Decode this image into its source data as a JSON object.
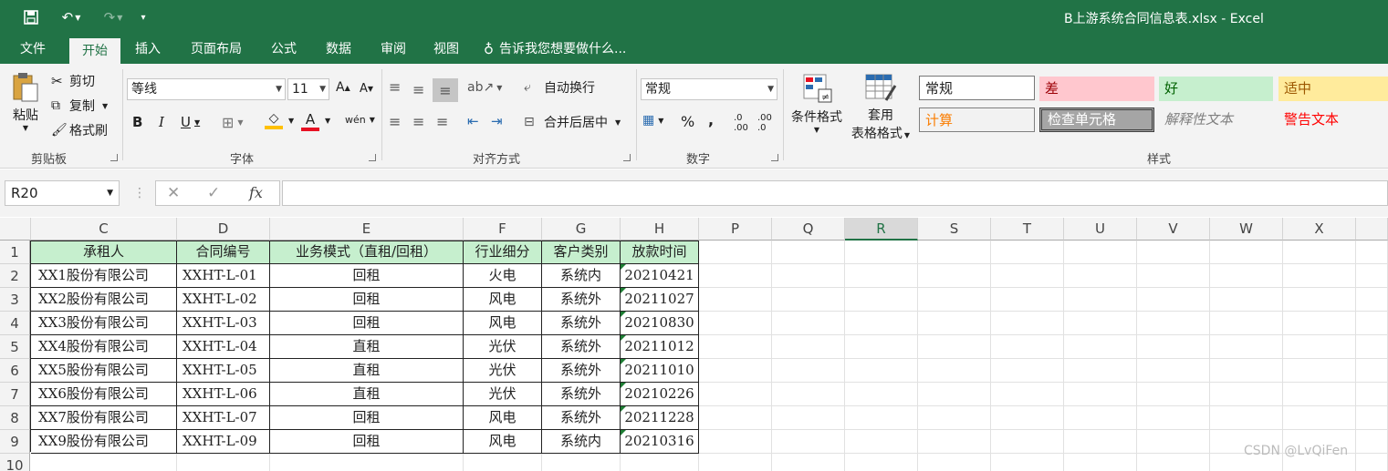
{
  "title": "B上游系统合同信息表.xlsx - Excel",
  "tabs": [
    "文件",
    "开始",
    "插入",
    "页面布局",
    "公式",
    "数据",
    "审阅",
    "视图"
  ],
  "tell_me": "告诉我您想要做什么...",
  "clipboard": {
    "paste": "粘贴",
    "cut": "剪切",
    "copy": "复制",
    "format_painter": "格式刷",
    "label": "剪贴板"
  },
  "font": {
    "name": "等线",
    "size": "11",
    "label": "字体"
  },
  "alignment": {
    "wrap": "自动换行",
    "merge": "合并后居中",
    "label": "对齐方式"
  },
  "number": {
    "format": "常规",
    "label": "数字"
  },
  "styles": {
    "cond_format": "条件格式",
    "table_format_1": "套用",
    "table_format_2": "表格格式",
    "cells": [
      "常规",
      "差",
      "好",
      "适中",
      "计算",
      "检查单元格",
      "解释性文本",
      "警告文本"
    ],
    "label": "样式"
  },
  "name_box": "R20",
  "columns": [
    "C",
    "D",
    "E",
    "F",
    "G",
    "H",
    "P",
    "Q",
    "R",
    "S",
    "T",
    "U",
    "V",
    "W",
    "X"
  ],
  "rows": [
    "1",
    "2",
    "3",
    "4",
    "5",
    "6",
    "7",
    "8",
    "9",
    "10"
  ],
  "table": {
    "headers": [
      "承租人",
      "合同编号",
      "业务模式（直租/回租）",
      "行业细分",
      "客户类别",
      "放款时间"
    ],
    "data": [
      [
        "XX1股份有限公司",
        "XXHT-L-01",
        "回租",
        "火电",
        "系统内",
        "20210421"
      ],
      [
        "XX2股份有限公司",
        "XXHT-L-02",
        "回租",
        "风电",
        "系统外",
        "20211027"
      ],
      [
        "XX3股份有限公司",
        "XXHT-L-03",
        "回租",
        "风电",
        "系统外",
        "20210830"
      ],
      [
        "XX4股份有限公司",
        "XXHT-L-04",
        "直租",
        "光伏",
        "系统外",
        "20211012"
      ],
      [
        "XX5股份有限公司",
        "XXHT-L-05",
        "直租",
        "光伏",
        "系统外",
        "20211010"
      ],
      [
        "XX6股份有限公司",
        "XXHT-L-06",
        "直租",
        "光伏",
        "系统外",
        "20210226"
      ],
      [
        "XX7股份有限公司",
        "XXHT-L-07",
        "回租",
        "风电",
        "系统外",
        "20211228"
      ],
      [
        "XX9股份有限公司",
        "XXHT-L-09",
        "回租",
        "风电",
        "系统内",
        "20210316"
      ]
    ]
  },
  "watermark": "CSDN @LvQiFen",
  "colors": {
    "excel_green": "#217346",
    "header_fill": "#c6efce",
    "bad_fill": "#ffc7ce",
    "neutral_fill": "#ffeb9c"
  }
}
